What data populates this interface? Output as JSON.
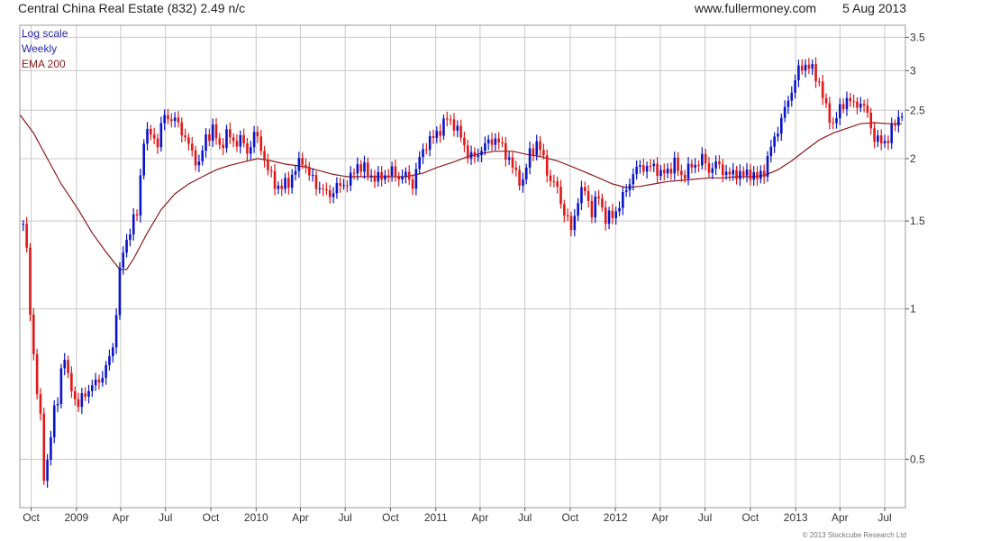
{
  "header": {
    "title": "Central China Real Estate (832) 2.49 n/c",
    "source": "www.fullermoney.com",
    "date": "5 Aug 2013"
  },
  "legend": {
    "scale": "Log scale",
    "period": "Weekly",
    "ema": "EMA 200"
  },
  "copyright": "© 2013 Stockcube Research Ltd",
  "colors": {
    "up": "#0a14c8",
    "down": "#e01818",
    "ema": "#8b1a1a",
    "grid": "#c8c8c8",
    "axis": "#555555",
    "scale_text": "#2a2aa6",
    "ema_text": "#8b1a1a"
  },
  "chart_data": {
    "type": "candlestick",
    "yscale": "log",
    "ylim": [
      0.4,
      3.7
    ],
    "yticks": [
      0.5,
      1,
      1.5,
      2,
      2.5,
      3,
      3.5
    ],
    "ytick_labels": [
      "0.5",
      "1",
      "1.5",
      "2",
      "2.5",
      "3",
      "3.5"
    ],
    "xlim": [
      "2008-09-08",
      "2013-08-12"
    ],
    "xticks": [
      {
        "date": "2008-10-01",
        "label": "Oct"
      },
      {
        "date": "2009-01-01",
        "label": "2009"
      },
      {
        "date": "2009-04-01",
        "label": "Apr"
      },
      {
        "date": "2009-07-01",
        "label": "Jul"
      },
      {
        "date": "2009-10-01",
        "label": "Oct"
      },
      {
        "date": "2010-01-01",
        "label": "2010"
      },
      {
        "date": "2010-04-01",
        "label": "Apr"
      },
      {
        "date": "2010-07-01",
        "label": "Jul"
      },
      {
        "date": "2010-10-01",
        "label": "Oct"
      },
      {
        "date": "2011-01-01",
        "label": "2011"
      },
      {
        "date": "2011-04-01",
        "label": "Apr"
      },
      {
        "date": "2011-07-01",
        "label": "Jul"
      },
      {
        "date": "2011-10-01",
        "label": "Oct"
      },
      {
        "date": "2012-01-01",
        "label": "2012"
      },
      {
        "date": "2012-04-01",
        "label": "Apr"
      },
      {
        "date": "2012-07-01",
        "label": "Jul"
      },
      {
        "date": "2012-10-01",
        "label": "Oct"
      },
      {
        "date": "2013-01-01",
        "label": "2013"
      },
      {
        "date": "2013-04-01",
        "label": "Apr"
      },
      {
        "date": "2013-07-01",
        "label": "Jul"
      }
    ],
    "grid": true,
    "close_path": [
      [
        "2008-09-15",
        1.48
      ],
      [
        "2008-09-22",
        1.3
      ],
      [
        "2008-09-29",
        0.98
      ],
      [
        "2008-10-06",
        0.82
      ],
      [
        "2008-10-13",
        0.68
      ],
      [
        "2008-10-20",
        0.6
      ],
      [
        "2008-10-27",
        0.46
      ],
      [
        "2008-11-03",
        0.5
      ],
      [
        "2008-11-10",
        0.56
      ],
      [
        "2008-11-17",
        0.62
      ],
      [
        "2008-11-24",
        0.66
      ],
      [
        "2008-12-01",
        0.76
      ],
      [
        "2008-12-08",
        0.8
      ],
      [
        "2008-12-15",
        0.72
      ],
      [
        "2008-12-22",
        0.7
      ],
      [
        "2008-12-29",
        0.66
      ],
      [
        "2009-01-05",
        0.64
      ],
      [
        "2009-01-19",
        0.68
      ],
      [
        "2009-02-02",
        0.7
      ],
      [
        "2009-02-16",
        0.72
      ],
      [
        "2009-03-02",
        0.76
      ],
      [
        "2009-03-16",
        0.84
      ],
      [
        "2009-03-30",
        1.18
      ],
      [
        "2009-04-06",
        1.3
      ],
      [
        "2009-04-20",
        1.45
      ],
      [
        "2009-05-04",
        1.55
      ],
      [
        "2009-05-18",
        2.2
      ],
      [
        "2009-06-01",
        2.25
      ],
      [
        "2009-06-15",
        2.15
      ],
      [
        "2009-06-29",
        2.45
      ],
      [
        "2009-07-13",
        2.4
      ],
      [
        "2009-07-27",
        2.35
      ],
      [
        "2009-08-10",
        2.2
      ],
      [
        "2009-08-24",
        2.05
      ],
      [
        "2009-09-07",
        1.95
      ],
      [
        "2009-09-21",
        2.2
      ],
      [
        "2009-10-05",
        2.3
      ],
      [
        "2009-10-19",
        2.1
      ],
      [
        "2009-11-02",
        2.25
      ],
      [
        "2009-11-16",
        2.15
      ],
      [
        "2009-11-30",
        2.2
      ],
      [
        "2009-12-14",
        2.05
      ],
      [
        "2009-12-28",
        2.25
      ],
      [
        "2010-01-11",
        2.1
      ],
      [
        "2010-01-25",
        1.9
      ],
      [
        "2010-02-08",
        1.78
      ],
      [
        "2010-02-22",
        1.75
      ],
      [
        "2010-03-08",
        1.8
      ],
      [
        "2010-03-22",
        1.9
      ],
      [
        "2010-04-05",
        2.0
      ],
      [
        "2010-04-19",
        1.85
      ],
      [
        "2010-05-03",
        1.78
      ],
      [
        "2010-05-17",
        1.72
      ],
      [
        "2010-05-31",
        1.7
      ],
      [
        "2010-06-14",
        1.75
      ],
      [
        "2010-06-28",
        1.78
      ],
      [
        "2010-07-12",
        1.82
      ],
      [
        "2010-07-26",
        1.95
      ],
      [
        "2010-08-09",
        1.9
      ],
      [
        "2010-08-23",
        1.85
      ],
      [
        "2010-09-06",
        1.82
      ],
      [
        "2010-09-20",
        1.86
      ],
      [
        "2010-10-04",
        1.88
      ],
      [
        "2010-10-18",
        1.84
      ],
      [
        "2010-11-01",
        1.85
      ],
      [
        "2010-11-15",
        1.78
      ],
      [
        "2010-11-29",
        2.0
      ],
      [
        "2010-12-13",
        2.15
      ],
      [
        "2010-12-27",
        2.2
      ],
      [
        "2011-01-10",
        2.3
      ],
      [
        "2011-01-24",
        2.4
      ],
      [
        "2011-02-07",
        2.35
      ],
      [
        "2011-02-21",
        2.2
      ],
      [
        "2011-03-07",
        2.05
      ],
      [
        "2011-03-21",
        2.0
      ],
      [
        "2011-04-04",
        2.1
      ],
      [
        "2011-04-18",
        2.15
      ],
      [
        "2011-05-02",
        2.2
      ],
      [
        "2011-05-16",
        2.1
      ],
      [
        "2011-05-30",
        2.0
      ],
      [
        "2011-06-13",
        1.85
      ],
      [
        "2011-06-27",
        1.8
      ],
      [
        "2011-07-11",
        2.05
      ],
      [
        "2011-07-25",
        2.15
      ],
      [
        "2011-08-08",
        2.0
      ],
      [
        "2011-08-22",
        1.8
      ],
      [
        "2011-09-05",
        1.75
      ],
      [
        "2011-09-19",
        1.55
      ],
      [
        "2011-10-03",
        1.45
      ],
      [
        "2011-10-17",
        1.65
      ],
      [
        "2011-10-31",
        1.75
      ],
      [
        "2011-11-14",
        1.55
      ],
      [
        "2011-11-28",
        1.7
      ],
      [
        "2011-12-12",
        1.5
      ],
      [
        "2011-12-26",
        1.55
      ],
      [
        "2012-01-09",
        1.6
      ],
      [
        "2012-01-23",
        1.75
      ],
      [
        "2012-02-06",
        1.85
      ],
      [
        "2012-02-20",
        1.95
      ],
      [
        "2012-03-05",
        1.9
      ],
      [
        "2012-03-19",
        1.95
      ],
      [
        "2012-04-02",
        1.85
      ],
      [
        "2012-04-16",
        1.9
      ],
      [
        "2012-04-30",
        1.95
      ],
      [
        "2012-05-14",
        1.85
      ],
      [
        "2012-05-28",
        1.9
      ],
      [
        "2012-06-11",
        1.95
      ],
      [
        "2012-06-25",
        2.0
      ],
      [
        "2012-07-09",
        1.9
      ],
      [
        "2012-07-23",
        1.95
      ],
      [
        "2012-08-06",
        1.9
      ],
      [
        "2012-08-20",
        1.85
      ],
      [
        "2012-09-03",
        1.88
      ],
      [
        "2012-09-17",
        1.85
      ],
      [
        "2012-10-01",
        1.88
      ],
      [
        "2012-10-15",
        1.82
      ],
      [
        "2012-10-29",
        1.9
      ],
      [
        "2012-11-12",
        2.1
      ],
      [
        "2012-11-26",
        2.3
      ],
      [
        "2012-12-10",
        2.5
      ],
      [
        "2012-12-24",
        2.75
      ],
      [
        "2013-01-07",
        3.0
      ],
      [
        "2013-01-21",
        3.1
      ],
      [
        "2013-02-04",
        3.0
      ],
      [
        "2013-02-18",
        2.85
      ],
      [
        "2013-03-04",
        2.5
      ],
      [
        "2013-03-18",
        2.35
      ],
      [
        "2013-04-01",
        2.5
      ],
      [
        "2013-04-15",
        2.65
      ],
      [
        "2013-04-29",
        2.55
      ],
      [
        "2013-05-13",
        2.6
      ],
      [
        "2013-05-27",
        2.45
      ],
      [
        "2013-06-10",
        2.2
      ],
      [
        "2013-06-24",
        2.15
      ],
      [
        "2013-07-08",
        2.2
      ],
      [
        "2013-07-22",
        2.35
      ],
      [
        "2013-08-05",
        2.49
      ]
    ],
    "ema_path": [
      [
        "2008-09-08",
        2.45
      ],
      [
        "2008-10-06",
        2.25
      ],
      [
        "2008-11-03",
        2.0
      ],
      [
        "2008-12-01",
        1.78
      ],
      [
        "2009-01-05",
        1.58
      ],
      [
        "2009-02-02",
        1.42
      ],
      [
        "2009-03-02",
        1.3
      ],
      [
        "2009-03-30",
        1.2
      ],
      [
        "2009-04-13",
        1.2
      ],
      [
        "2009-04-27",
        1.26
      ],
      [
        "2009-05-25",
        1.42
      ],
      [
        "2009-06-22",
        1.58
      ],
      [
        "2009-07-20",
        1.7
      ],
      [
        "2009-08-17",
        1.78
      ],
      [
        "2009-09-14",
        1.84
      ],
      [
        "2009-10-12",
        1.9
      ],
      [
        "2009-11-09",
        1.94
      ],
      [
        "2009-12-07",
        1.97
      ],
      [
        "2010-01-04",
        2.0
      ],
      [
        "2010-02-01",
        1.98
      ],
      [
        "2010-03-01",
        1.95
      ],
      [
        "2010-04-05",
        1.93
      ],
      [
        "2010-05-03",
        1.9
      ],
      [
        "2010-06-07",
        1.86
      ],
      [
        "2010-07-05",
        1.84
      ],
      [
        "2010-08-09",
        1.84
      ],
      [
        "2010-09-06",
        1.84
      ],
      [
        "2010-10-04",
        1.84
      ],
      [
        "2010-11-01",
        1.84
      ],
      [
        "2010-12-06",
        1.87
      ],
      [
        "2011-01-03",
        1.92
      ],
      [
        "2011-02-07",
        1.97
      ],
      [
        "2011-03-07",
        2.02
      ],
      [
        "2011-04-04",
        2.05
      ],
      [
        "2011-05-02",
        2.07
      ],
      [
        "2011-06-06",
        2.07
      ],
      [
        "2011-07-04",
        2.04
      ],
      [
        "2011-08-01",
        2.02
      ],
      [
        "2011-09-05",
        1.98
      ],
      [
        "2011-10-03",
        1.93
      ],
      [
        "2011-10-31",
        1.88
      ],
      [
        "2011-11-28",
        1.83
      ],
      [
        "2011-12-26",
        1.78
      ],
      [
        "2012-01-23",
        1.75
      ],
      [
        "2012-02-20",
        1.76
      ],
      [
        "2012-03-19",
        1.78
      ],
      [
        "2012-04-16",
        1.8
      ],
      [
        "2012-05-14",
        1.81
      ],
      [
        "2012-06-11",
        1.82
      ],
      [
        "2012-07-09",
        1.83
      ],
      [
        "2012-08-06",
        1.83
      ],
      [
        "2012-09-03",
        1.84
      ],
      [
        "2012-10-01",
        1.84
      ],
      [
        "2012-10-29",
        1.85
      ],
      [
        "2012-11-26",
        1.9
      ],
      [
        "2012-12-24",
        1.98
      ],
      [
        "2013-01-21",
        2.08
      ],
      [
        "2013-02-18",
        2.18
      ],
      [
        "2013-03-18",
        2.25
      ],
      [
        "2013-04-15",
        2.3
      ],
      [
        "2013-05-13",
        2.35
      ],
      [
        "2013-06-10",
        2.36
      ],
      [
        "2013-07-08",
        2.35
      ],
      [
        "2013-08-05",
        2.35
      ]
    ]
  }
}
